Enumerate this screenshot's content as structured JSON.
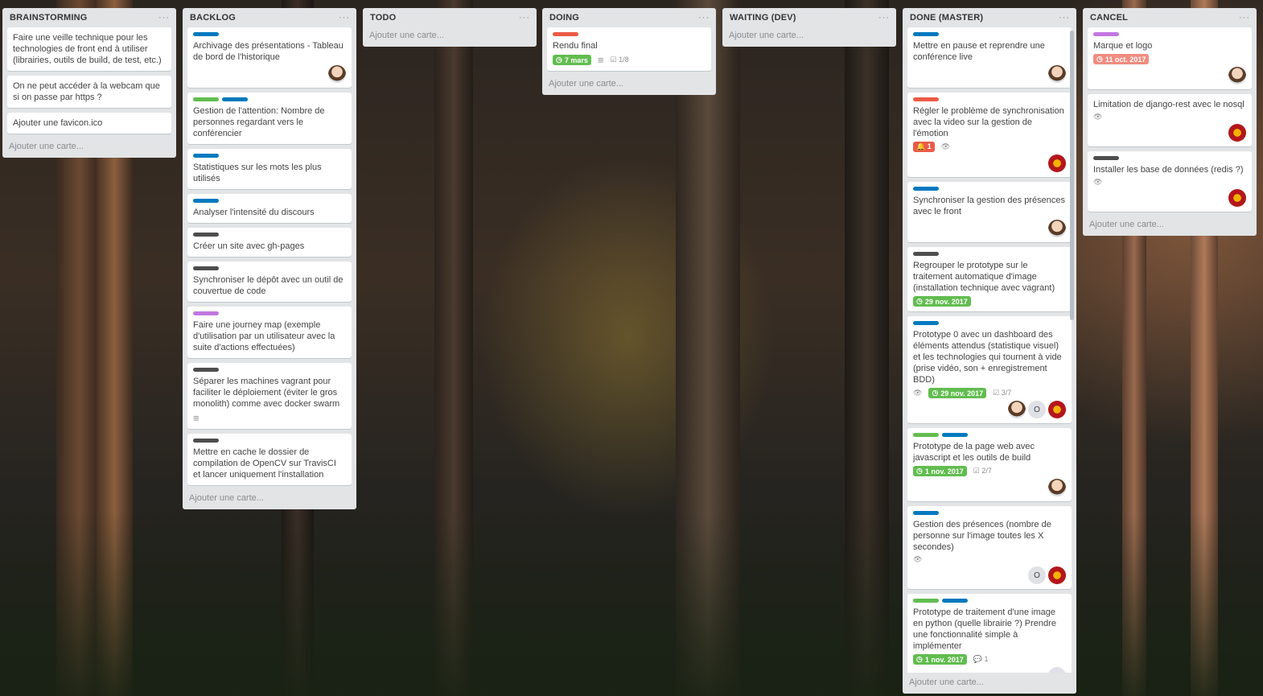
{
  "colors": {
    "green": "#61bd4f",
    "blue": "#0079bf",
    "red": "#eb5a46",
    "purple": "#c377e0",
    "black": "#4d4d4d"
  },
  "lists": [
    {
      "title": "BRAINSTORMING",
      "add_label": "Ajouter une carte...",
      "cards": [
        {
          "title": "Faire une veille technique pour les technologies de front end à utiliser (librairies, outils de build, de test, etc.)"
        },
        {
          "title": "On ne peut accéder à la webcam que si on passe par https ?"
        },
        {
          "title": "Ajouter une favicon.ico"
        }
      ]
    },
    {
      "title": "BACKLOG",
      "add_label": "Ajouter une carte...",
      "cards": [
        {
          "labels": [
            "blue"
          ],
          "title": "Archivage des présentations - Tableau de bord de l'historique",
          "members": [
            "face"
          ]
        },
        {
          "labels": [
            "green",
            "blue"
          ],
          "title": "Gestion de l'attention: Nombre de personnes regardant vers le conférencier"
        },
        {
          "labels": [
            "blue"
          ],
          "title": "Statistiques sur les mots les plus utilisés"
        },
        {
          "labels": [
            "blue"
          ],
          "title": "Analyser l'intensité du discours"
        },
        {
          "labels": [
            "black"
          ],
          "title": "Créer un site avec gh-pages"
        },
        {
          "labels": [
            "black"
          ],
          "title": "Synchroniser le dépôt avec un outil de couvertue de code"
        },
        {
          "labels": [
            "purple"
          ],
          "title": "Faire une journey map (exemple d'utilisation par un utilisateur avec la suite d'actions effectuées)"
        },
        {
          "labels": [
            "black"
          ],
          "title": "Séparer les machines vagrant pour faciliter le déploiement (éviter le gros monolith) comme avec docker swarm",
          "description": true
        },
        {
          "labels": [
            "black"
          ],
          "title": "Mettre en cache le dossier de compilation de OpenCV sur TravisCI et lancer uniquement l'installation"
        }
      ]
    },
    {
      "title": "TODO",
      "add_label": "Ajouter une carte...",
      "cards": []
    },
    {
      "title": "DOING",
      "add_label": "Ajouter une carte...",
      "cards": [
        {
          "labels": [
            "red"
          ],
          "title": "Rendu final",
          "due": "7 mars",
          "due_color": "green",
          "description": true,
          "checklist": "1/8"
        }
      ]
    },
    {
      "title": "WAITING (DEV)",
      "add_label": "Ajouter une carte...",
      "cards": []
    },
    {
      "title": "DONE (MASTER)",
      "add_label": "Ajouter une carte...",
      "cards": [
        {
          "labels": [
            "blue"
          ],
          "title": "Mettre en pause et reprendre une conférence live",
          "members": [
            "face"
          ]
        },
        {
          "labels": [
            "red"
          ],
          "title": "Régler le problème de synchronisation avec la video sur la gestion de l'émotion",
          "alert": "1",
          "watch": true,
          "members": [
            "logo"
          ]
        },
        {
          "labels": [
            "blue"
          ],
          "title": "Synchroniser la gestion des présences avec le front",
          "members": [
            "face"
          ]
        },
        {
          "labels": [
            "black"
          ],
          "title": "Regrouper le prototype sur le traitement automatique d'image (installation technique avec vagrant)",
          "due": "29 nov. 2017",
          "due_color": "green"
        },
        {
          "labels": [
            "blue"
          ],
          "title": "Prototype 0 avec un dashboard des éléments attendus (statistique visuel) et les technologies qui tournent à vide (prise vidéo, son + enregistrement BDD)",
          "watch": true,
          "due": "29 nov. 2017",
          "due_color": "green",
          "checklist": "3/7",
          "members": [
            "face",
            "O",
            "logo"
          ]
        },
        {
          "labels": [
            "green",
            "blue"
          ],
          "title": "Prototype de la page web avec javascript et les outils de build",
          "due": "1 nov. 2017",
          "due_color": "green",
          "checklist": "2/7",
          "members": [
            "face"
          ]
        },
        {
          "labels": [
            "blue"
          ],
          "title": "Gestion des présences (nombre de personne sur l'image toutes les X secondes)",
          "watch": true,
          "members": [
            "O",
            "logo"
          ]
        },
        {
          "labels": [
            "green",
            "blue"
          ],
          "title": "Prototype de traitement d'une image en python (quelle librairie ?) Prendre une fonctionnalité simple à implémenter",
          "due": "1 nov. 2017",
          "due_color": "green",
          "comments": "1",
          "members": [
            "O"
          ]
        }
      ]
    },
    {
      "title": "CANCEL",
      "add_label": "Ajouter une carte...",
      "cards": [
        {
          "labels": [
            "purple"
          ],
          "title": "Marque et logo",
          "due": "11 oct. 2017",
          "due_color": "red",
          "members": [
            "face"
          ]
        },
        {
          "title": "Limitation de django-rest avec le nosql",
          "watch": true,
          "members": [
            "logo"
          ]
        },
        {
          "labels": [
            "black"
          ],
          "title": "Installer les base de données (redis ?)",
          "watch": true,
          "members": [
            "logo"
          ]
        }
      ]
    }
  ]
}
